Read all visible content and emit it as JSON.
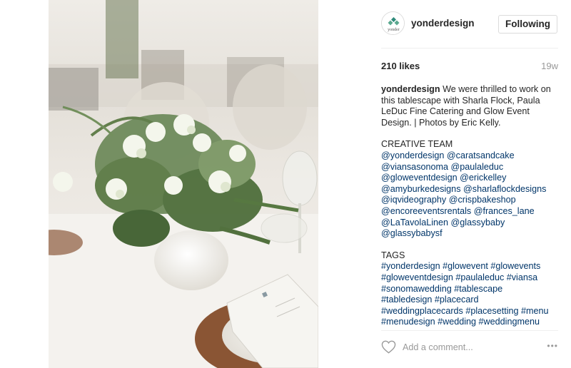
{
  "post": {
    "username": "yonderdesign",
    "follow_label": "Following",
    "avatar_text": "yonder",
    "likes": "210 likes",
    "age": "19w",
    "caption": {
      "author": "yonderdesign",
      "text": " We were thrilled to work on this tablescape with Sharla Flock, Paula LeDuc Fine Catering and Glow Event Design. | Photos by Eric Kelly."
    },
    "creative_team": {
      "title": "CREATIVE TEAM",
      "lines": [
        "@yonderdesign @caratsandcake",
        "@viansasonoma @paulaleduc",
        "@gloweventdesign @erickelley",
        "@amyburkedesigns @sharlaflockdesigns",
        "@iqvideography @crispbakeshop",
        "@encoreeventsrentals @frances_lane",
        "@LaTavolaLinen @glassybaby",
        "@glassybabysf"
      ]
    },
    "tags": {
      "title": "TAGS",
      "lines": [
        "#yonderdesign #glowevent #glowevents",
        "#gloweventdesign #paulaleduc #viansa",
        "#sonomawedding #tablescape",
        "#tabledesign #placecard",
        "#weddingplacecards #placesetting #menu",
        "#menudesign #wedding #weddingmenu"
      ]
    },
    "comment_placeholder": "Add a comment...",
    "more_label": "•••"
  },
  "colors": {
    "link": "#003569",
    "text": "#262626",
    "muted": "#999999",
    "border": "#dbdbdb"
  },
  "icons": {
    "like": "heart-icon",
    "more": "more-options-icon",
    "avatar_logo": "yonder-logo-icon"
  }
}
